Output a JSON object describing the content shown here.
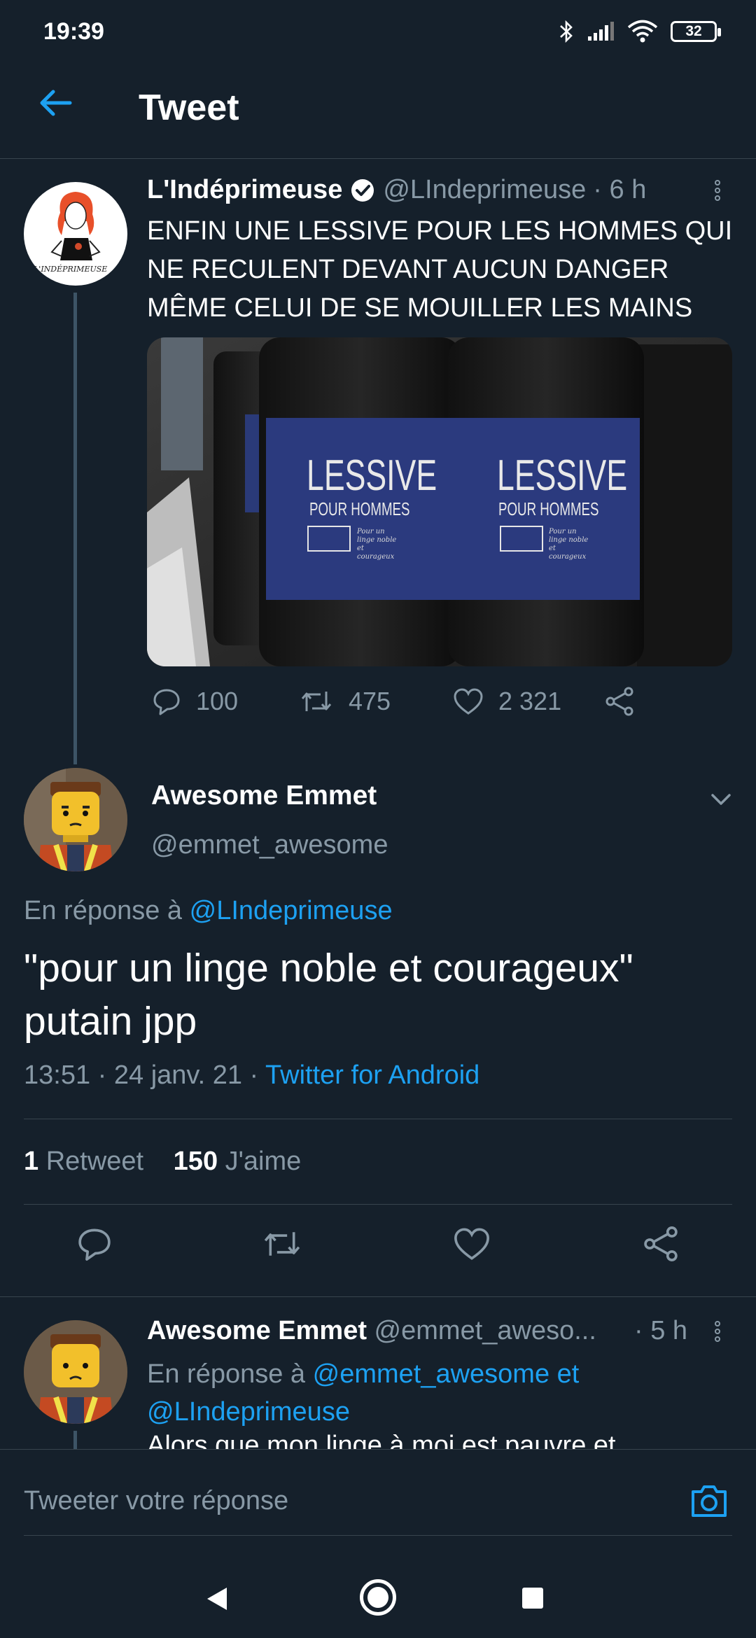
{
  "status_bar": {
    "time": "19:39",
    "battery": "32",
    "icons": [
      "bluetooth-icon",
      "signal-icon",
      "wifi-icon",
      "battery-icon"
    ]
  },
  "header": {
    "title": "Tweet"
  },
  "tweet_parent": {
    "name": "L'Indéprimeuse",
    "handle": "@LIndeprimeuse",
    "time": "· 6 h",
    "text": "ENFIN UNE LESSIVE POUR LES HOMMES QUI NE RECULENT DEVANT AUCUN DANGER MÊME CELUI DE SE MOUILLER LES MAINS",
    "avatar_caption": "L'INDÉPRIMEUSE",
    "image_label_title": "LESSIVE",
    "image_label_subtitle": "POUR HOMMES",
    "image_label_tagline": "Pour un linge noble et courageux",
    "replies": "100",
    "retweets": "475",
    "likes": "2 321"
  },
  "tweet_main": {
    "name": "Awesome Emmet",
    "handle": "@emmet_awesome",
    "reply_prefix": "En réponse à",
    "reply_handle": "@LIndeprimeuse",
    "text_line1": "\"pour un linge noble et courageux\"",
    "text_line2": "putain jpp",
    "timestamp": "13:51 · 24 janv. 21 ·",
    "source": "Twitter for Android",
    "retweet_count": "1",
    "retweet_label": "Retweet",
    "like_count": "150",
    "like_label": "J'aime"
  },
  "tweet_reply": {
    "name": "Awesome Emmet",
    "handle": "@emmet_aweso...",
    "time": "· 5 h",
    "reply_prefix": "En réponse à",
    "reply_handles_line1": "@emmet_awesome et",
    "reply_handles_line2": "@LIndeprimeuse",
    "text_partial": "Alors que mon linge à moi est pauvre et"
  },
  "composer": {
    "placeholder": "Tweeter votre réponse"
  },
  "colors": {
    "background": "#15202b",
    "accent": "#1da1f2",
    "muted": "#8899a6",
    "divider": "#38444d"
  }
}
